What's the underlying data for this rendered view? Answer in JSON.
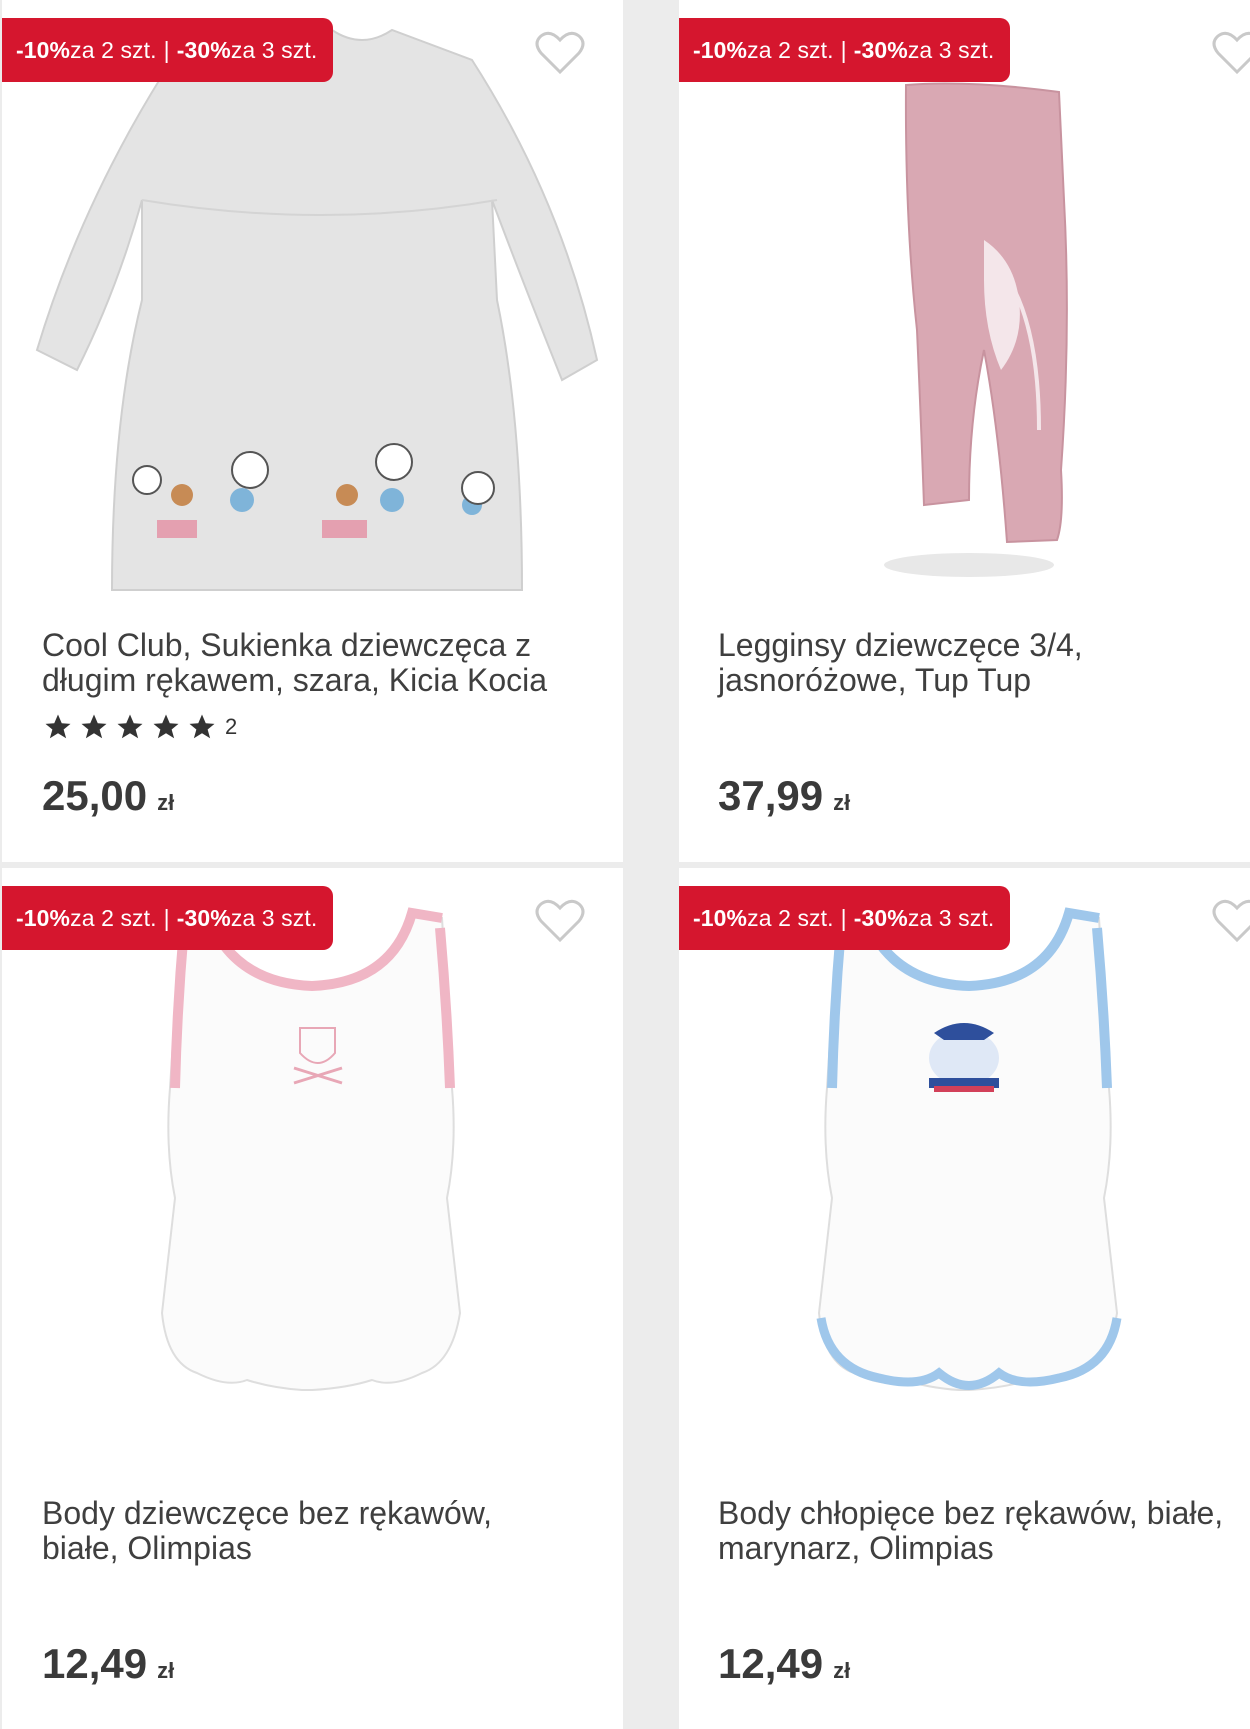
{
  "products": [
    {
      "promo_part1_pct": "-10%",
      "promo_part1_text": " za 2 szt.",
      "promo_sep": "|",
      "promo_part2_pct": "-30%",
      "promo_part2_text": " za 3 szt.",
      "title_line1": "Cool Club, Sukienka dziewczęca z",
      "title_line2": "długim rękawem, szara, Kicia Kocia",
      "rating_stars": 5,
      "rating_count": "2",
      "price": "25,00",
      "currency": "zł",
      "image": "gray-dress-with-cats"
    },
    {
      "promo_part1_pct": "-10%",
      "promo_part1_text": " za 2 szt.",
      "promo_sep": "|",
      "promo_part2_pct": "-30%",
      "promo_part2_text": " za 3 szt.",
      "title_line1": "Legginsy dziewczęce 3/4,",
      "title_line2": "jasnoróżowe, Tup Tup",
      "price": "37,99",
      "currency": "zł",
      "image": "pink-leggings"
    },
    {
      "promo_part1_pct": "-10%",
      "promo_part1_text": " za 2 szt.",
      "promo_sep": "|",
      "promo_part2_pct": "-30%",
      "promo_part2_text": " za 3 szt.",
      "title_line1": "Body dziewczęce bez rękawów,",
      "title_line2": "białe, Olimpias",
      "price": "12,49",
      "currency": "zł",
      "image": "white-pink-bodysuit"
    },
    {
      "promo_part1_pct": "-10%",
      "promo_part1_text": " za 2 szt.",
      "promo_sep": "|",
      "promo_part2_pct": "-30%",
      "promo_part2_text": " za 3 szt.",
      "title_line1": "Body chłopięce bez rękawów, białe,",
      "title_line2": "marynarz, Olimpias",
      "price": "12,49",
      "currency": "zł",
      "image": "white-blue-bodysuit"
    }
  ],
  "colors": {
    "promo_bg": "#d5162e",
    "text": "#3d3d3d",
    "divider": "#ececec"
  },
  "icons": {
    "favorite": "heart-outline-icon",
    "rating": "star-filled-icon"
  }
}
